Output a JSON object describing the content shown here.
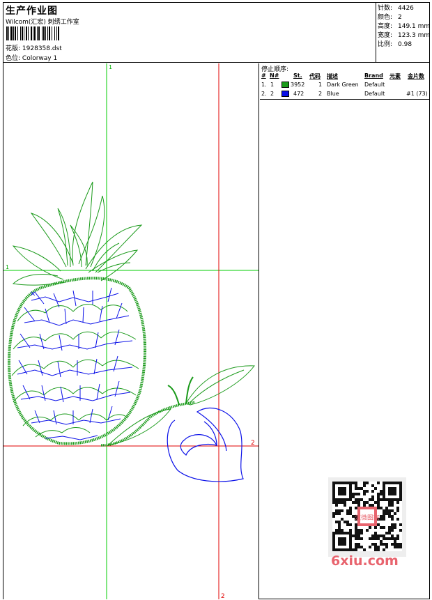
{
  "header": {
    "title": "生产作业图",
    "studio": "Wilcom(汇宏) 刺绣工作室",
    "design_label": "花版:",
    "design_file": "1928358.dst",
    "colorway_label": "色位:",
    "colorway": "Colorway 1"
  },
  "stats": [
    {
      "key": "针数:",
      "value": "4426"
    },
    {
      "key": "颜色:",
      "value": "2"
    },
    {
      "key": "高度:",
      "value": "149.1 mm"
    },
    {
      "key": "宽度:",
      "value": "123.3 mm"
    },
    {
      "key": "比例:",
      "value": "0.98"
    }
  ],
  "guides": {
    "green_top": "1",
    "green_left": "1",
    "red_right": "2",
    "red_bottom": "2"
  },
  "stop_sequence": {
    "title": "停止顺序:",
    "headers": {
      "hash": "#",
      "no": "N#",
      "st": "St.",
      "code": "代码",
      "desc": "描述",
      "brand": "Brand",
      "element": "元素",
      "sequin": "金片数"
    },
    "rows": [
      {
        "idx": "1.",
        "no": "1",
        "color": "#1a9a1a",
        "stitches": "3952",
        "code": "1",
        "desc": "Dark Green",
        "brand": "Default",
        "sequin": ""
      },
      {
        "idx": "2.",
        "no": "2",
        "color": "#0a10e8",
        "stitches": "472",
        "code": "2",
        "desc": "Blue",
        "brand": "Default",
        "sequin": "#1 (73)"
      }
    ]
  },
  "watermark": {
    "text": "6xiu.com",
    "qr_stamp": "汉微图案"
  },
  "colors": {
    "green": "#1a9a1a",
    "blue": "#0a10e8",
    "guide_green": "#00cc00",
    "guide_red": "#e00000",
    "watermark": "#e8646e"
  }
}
